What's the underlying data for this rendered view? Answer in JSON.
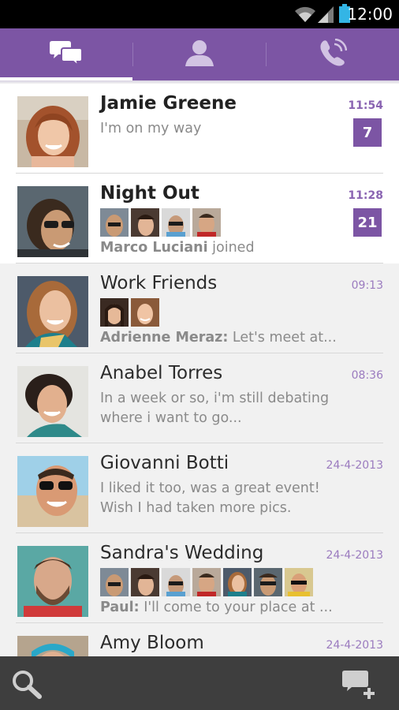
{
  "status_bar": {
    "time": "12:00"
  },
  "tabs": [
    {
      "icon": "chats-icon"
    },
    {
      "icon": "contacts-icon"
    },
    {
      "icon": "calls-icon"
    }
  ],
  "conversations": [
    {
      "name": "Jamie Greene",
      "time": "11:54",
      "preview": "I'm on my way",
      "unread": "7"
    },
    {
      "name": "Night Out",
      "time": "11:28",
      "unread": "21",
      "sender": "Marco Luciani",
      "message": " joined"
    },
    {
      "name": "Work Friends",
      "time": "09:13",
      "sender": "Adrienne Meraz:",
      "message": " Let's meet at..."
    },
    {
      "name": "Anabel Torres",
      "time": "08:36",
      "preview": "In a week or so, i'm still debating where i want to go..."
    },
    {
      "name": "Giovanni Botti",
      "time": "24-4-2013",
      "preview": "I liked it too, was a great event! Wish I had taken more pics."
    },
    {
      "name": "Sandra's Wedding",
      "time": "24-4-2013",
      "sender": "Paul:",
      "message": " I'll come to your place at ..."
    },
    {
      "name": "Amy Bloom",
      "time": "24-4-2013"
    }
  ],
  "colors": {
    "brand": "#7c55a4",
    "time_accent": "#9b7bbf",
    "bottom_bar": "#3e3e3e"
  },
  "bottom_bar": {
    "left_icon": "search-icon",
    "right_icon": "new-message-icon"
  }
}
